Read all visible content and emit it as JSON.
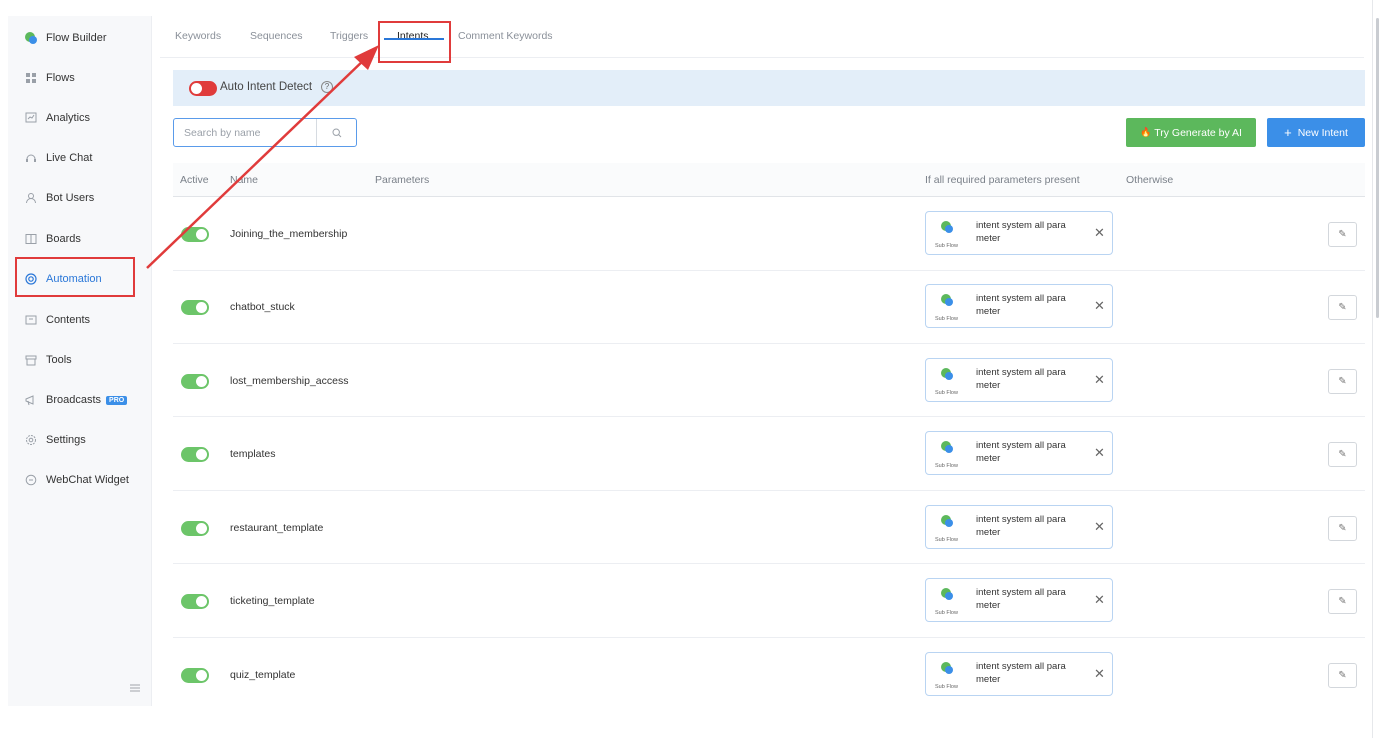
{
  "sidebar": {
    "items": [
      {
        "label": "Flow Builder",
        "icon": "flow-builder-logo-icon"
      },
      {
        "label": "Flows",
        "icon": "grid-icon"
      },
      {
        "label": "Analytics",
        "icon": "analytics-icon"
      },
      {
        "label": "Live Chat",
        "icon": "headset-icon"
      },
      {
        "label": "Bot Users",
        "icon": "user-icon"
      },
      {
        "label": "Boards",
        "icon": "board-icon"
      },
      {
        "label": "Automation",
        "icon": "automation-icon",
        "active": true
      },
      {
        "label": "Contents",
        "icon": "contents-icon"
      },
      {
        "label": "Tools",
        "icon": "tools-icon"
      },
      {
        "label": "Broadcasts",
        "icon": "megaphone-icon",
        "badge": "PRO"
      },
      {
        "label": "Settings",
        "icon": "gear-icon"
      },
      {
        "label": "WebChat Widget",
        "icon": "chat-icon"
      }
    ],
    "collapse_icon": "menu-collapse-icon"
  },
  "tabs": [
    {
      "label": "Keywords"
    },
    {
      "label": "Sequences"
    },
    {
      "label": "Triggers"
    },
    {
      "label": "Intents",
      "active": true
    },
    {
      "label": "Comment Keywords"
    }
  ],
  "auto_intent": {
    "label": "Auto Intent Detect",
    "help_icon": "?",
    "enabled": false
  },
  "search": {
    "placeholder": "Search by name",
    "value": ""
  },
  "buttons": {
    "try_ai": "Try Generate by AI",
    "try_ai_icon": "🔥",
    "new_intent": "New Intent",
    "new_intent_icon": "+"
  },
  "table": {
    "headers": {
      "active": "Active",
      "name": "Name",
      "parameters": "Parameters",
      "if_present": "If all required parameters present",
      "otherwise": "Otherwise"
    },
    "rows": [
      {
        "name": "Joining_the_membership",
        "active": true,
        "flow_text": "intent system all para meter",
        "flow_sub": "Sub Flow"
      },
      {
        "name": "chatbot_stuck",
        "active": true,
        "flow_text": "intent system all para meter",
        "flow_sub": "Sub Flow"
      },
      {
        "name": "lost_membership_access",
        "active": true,
        "flow_text": "intent system all para meter",
        "flow_sub": "Sub Flow"
      },
      {
        "name": "templates",
        "active": true,
        "flow_text": "intent system all para meter",
        "flow_sub": "Sub Flow"
      },
      {
        "name": "restaurant_template",
        "active": true,
        "flow_text": "intent system all para meter",
        "flow_sub": "Sub Flow"
      },
      {
        "name": "ticketing_template",
        "active": true,
        "flow_text": "intent system all para meter",
        "flow_sub": "Sub Flow"
      },
      {
        "name": "quiz_template",
        "active": true,
        "flow_text": "intent system all para meter",
        "flow_sub": "Sub Flow"
      }
    ]
  },
  "colors": {
    "accent": "#2a77d8",
    "highlight": "#e03b3b",
    "toggle_on": "#6cc569",
    "ai_button": "#5cb85c",
    "new_button": "#3b8fe8"
  }
}
